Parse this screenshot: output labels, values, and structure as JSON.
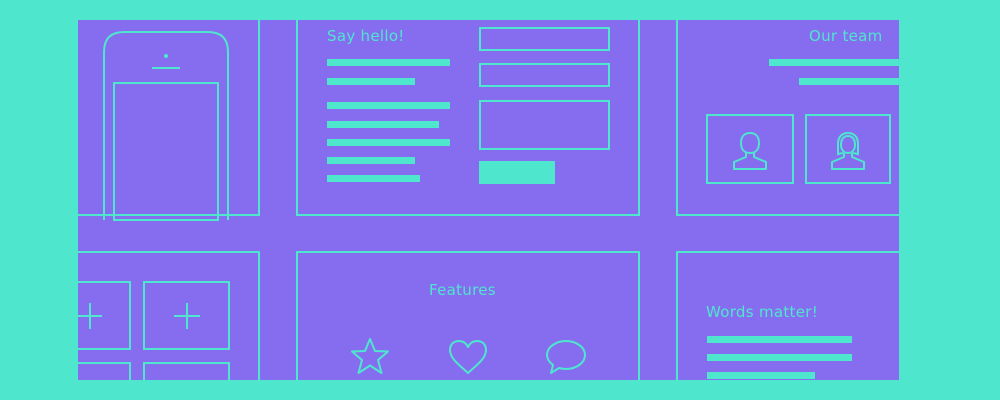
{
  "colors": {
    "background": "#4ee6cd",
    "canvas": "#866df0",
    "stroke": "#4ee6cd"
  },
  "contact_panel": {
    "heading": "Say hello!"
  },
  "team_panel": {
    "heading": "Our team",
    "avatars": [
      "male-user-icon",
      "female-user-icon"
    ]
  },
  "features_panel": {
    "heading": "Features",
    "icons": [
      "star-icon",
      "heart-icon",
      "speech-bubble-icon"
    ]
  },
  "words_panel": {
    "heading": "Words matter!"
  },
  "grid_panel": {
    "icons": [
      "plus-icon",
      "plus-icon"
    ]
  },
  "phone_panel": {
    "icon": "smartphone-icon"
  }
}
